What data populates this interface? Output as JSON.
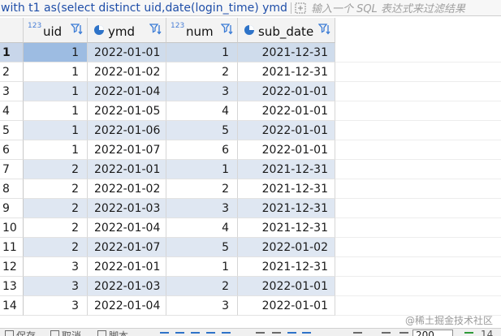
{
  "filter_bar": {
    "query": "with t1 as(select distinct uid,date(login_time) ymd",
    "filter_placeholder": "输入一个 SQL 表达式来过滤结果"
  },
  "grid": {
    "columns": [
      {
        "key": "uid",
        "label": "uid",
        "type_tag": "123",
        "type": "numeric"
      },
      {
        "key": "ymd",
        "label": "ymd",
        "type": "date"
      },
      {
        "key": "num",
        "label": "num",
        "type_tag": "123",
        "type": "numeric"
      },
      {
        "key": "sub_date",
        "label": "sub_date",
        "type": "date"
      }
    ],
    "rows": [
      {
        "n": "1",
        "uid": "1",
        "ymd": "2022-01-01",
        "num": "1",
        "sub_date": "2021-12-31"
      },
      {
        "n": "2",
        "uid": "1",
        "ymd": "2022-01-02",
        "num": "2",
        "sub_date": "2021-12-31"
      },
      {
        "n": "3",
        "uid": "1",
        "ymd": "2022-01-04",
        "num": "3",
        "sub_date": "2022-01-01"
      },
      {
        "n": "4",
        "uid": "1",
        "ymd": "2022-01-05",
        "num": "4",
        "sub_date": "2022-01-01"
      },
      {
        "n": "5",
        "uid": "1",
        "ymd": "2022-01-06",
        "num": "5",
        "sub_date": "2022-01-01"
      },
      {
        "n": "6",
        "uid": "1",
        "ymd": "2022-01-07",
        "num": "6",
        "sub_date": "2022-01-01"
      },
      {
        "n": "7",
        "uid": "2",
        "ymd": "2022-01-01",
        "num": "1",
        "sub_date": "2021-12-31"
      },
      {
        "n": "8",
        "uid": "2",
        "ymd": "2022-01-02",
        "num": "2",
        "sub_date": "2021-12-31"
      },
      {
        "n": "9",
        "uid": "2",
        "ymd": "2022-01-03",
        "num": "3",
        "sub_date": "2021-12-31"
      },
      {
        "n": "10",
        "uid": "2",
        "ymd": "2022-01-04",
        "num": "4",
        "sub_date": "2021-12-31"
      },
      {
        "n": "11",
        "uid": "2",
        "ymd": "2022-01-07",
        "num": "5",
        "sub_date": "2022-01-02"
      },
      {
        "n": "12",
        "uid": "3",
        "ymd": "2022-01-01",
        "num": "1",
        "sub_date": "2021-12-31"
      },
      {
        "n": "13",
        "uid": "3",
        "ymd": "2022-01-03",
        "num": "2",
        "sub_date": "2022-01-01"
      },
      {
        "n": "14",
        "uid": "3",
        "ymd": "2022-01-04",
        "num": "3",
        "sub_date": "2022-01-01"
      }
    ],
    "selected_row": 0
  },
  "watermark": "@稀土掘金技术社区",
  "toolbar": {
    "save_label": "保存",
    "cancel_label": "取消",
    "script_label": "脚本",
    "fetch_size": "200",
    "row_count": "14"
  },
  "colors": {
    "accent": "#1f4ea8",
    "row_alt": "#dfe7f2",
    "selected_cell": "#9dbce2"
  }
}
